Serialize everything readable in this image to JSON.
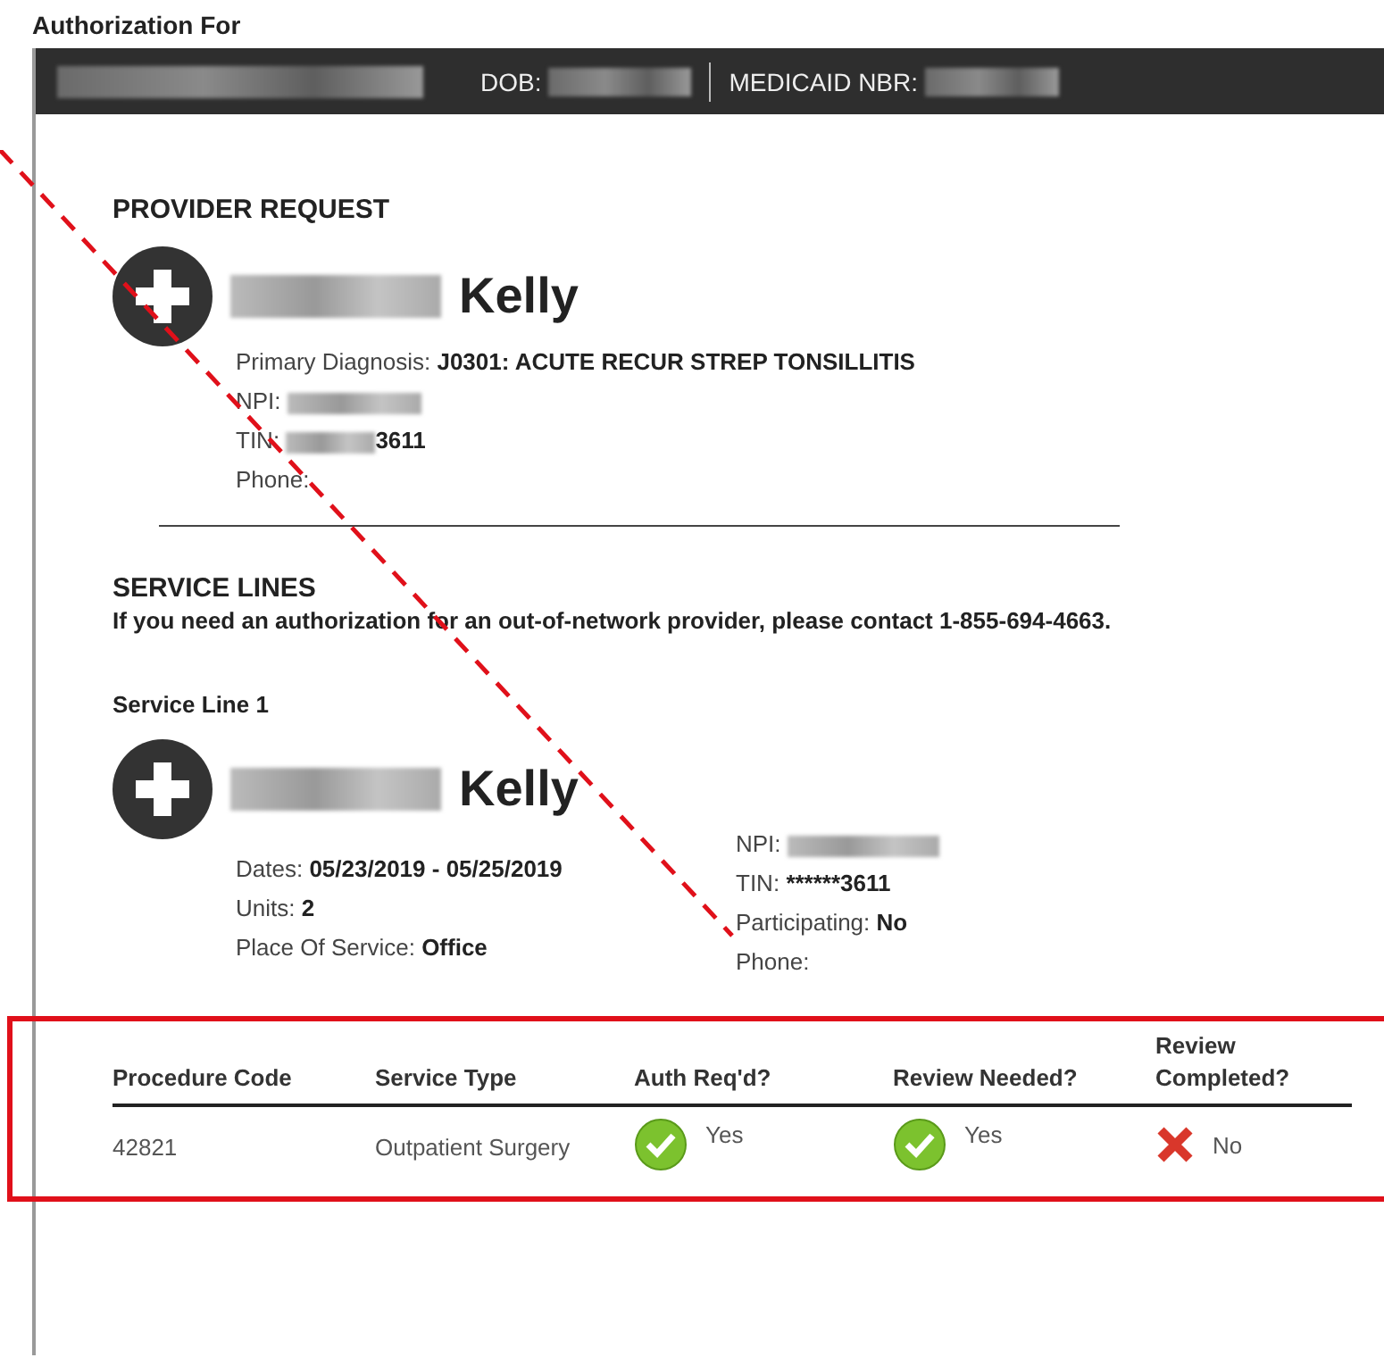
{
  "title": "Authorization For",
  "member_bar": {
    "name_redacted": true,
    "fields": [
      {
        "label": "DOB:",
        "redacted": true
      },
      {
        "label": "MEDICAID NBR:",
        "redacted": true
      }
    ]
  },
  "provider_request": {
    "heading": "PROVIDER REQUEST",
    "first_name_redacted": true,
    "name": "Kelly",
    "details": [
      {
        "label": "Primary Diagnosis:",
        "value": "J0301: ACUTE RECUR STREP TONSILLITIS",
        "redacted": false
      },
      {
        "label": "NPI:",
        "redacted": true
      },
      {
        "label": "TIN:",
        "value": "3611",
        "redacted": true
      },
      {
        "label": "Phone:",
        "redacted": false
      }
    ]
  },
  "service_lines": {
    "heading": "SERVICE LINES",
    "note": "If you need an authorization for an out-of-network provider, please contact 1-855-694-4663.",
    "lines": [
      {
        "title": "Service Line 1",
        "first_name_redacted": true,
        "name": "Kelly",
        "left_details": [
          {
            "label": "Dates:",
            "value": "05/23/2019 - 05/25/2019"
          },
          {
            "label": "Units:",
            "value": "2"
          },
          {
            "label": "Place Of Service:",
            "value": "Office"
          }
        ],
        "right_details": [
          {
            "label": "NPI:",
            "redacted": true
          },
          {
            "label": "TIN:",
            "value": "******3611",
            "redacted": false
          },
          {
            "label": "Participating:",
            "value": "No",
            "redacted": false
          },
          {
            "label": "Phone:",
            "redacted": false
          }
        ],
        "table": {
          "columns": [
            "Procedure Code",
            "Service Type",
            "Auth Req'd?",
            "Review Needed?",
            "Review Completed?"
          ],
          "rows": [
            [
              {
                "kind": "text",
                "text": "42821"
              },
              {
                "kind": "text",
                "text": "Outpatient Surgery"
              },
              {
                "kind": "status",
                "checked": true,
                "text": "Yes"
              },
              {
                "kind": "status",
                "checked": true,
                "text": "Yes"
              },
              {
                "kind": "status",
                "checked": false,
                "text": "No"
              }
            ]
          ]
        }
      }
    ]
  },
  "annotations": {
    "dashed_line": true,
    "highlight_frame": true
  }
}
